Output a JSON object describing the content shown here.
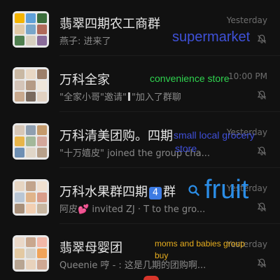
{
  "chats": [
    {
      "title": "翡翠四期农工商群",
      "keycap": "",
      "preview_parts": [
        "燕子: 进来了"
      ],
      "time": "Yesterday",
      "muted": true,
      "avatar_tiles": [
        "#f4b400",
        "#5fa0d8",
        "#3c6e3c",
        "#e0c9a6",
        "#79a6c9",
        "#b06a5a",
        "#4f7f4f",
        "#d8d0c0",
        "#8a6c9a"
      ]
    },
    {
      "title": "万科全家",
      "keycap": "",
      "preview_parts": [
        "\"全家小哥\"邀请\"",
        "\"加入了群聊"
      ],
      "time": "10:00 PM",
      "muted": true,
      "avatar_tiles": [
        "#c9b8a3",
        "#e8d7c4",
        "#9c7f6a",
        "#d4c4b8",
        "#b59b86",
        "#efe6da",
        "#c8a98e",
        "#7a6a5e",
        "#e2d2c2"
      ]
    },
    {
      "title": "万科清美团购。四期",
      "keycap": "",
      "preview_parts": [
        "\"十万嬉皮\" joined the group cha..."
      ],
      "time": "Yesterday",
      "muted": true,
      "avatar_tiles": [
        "#d7c7b7",
        "#8f9fb0",
        "#c49a6c",
        "#e8b54a",
        "#a3b89a",
        "#d3a79b",
        "#6e8fb3",
        "#e0d6c8",
        "#b7a08a"
      ]
    },
    {
      "title": "万科水果群四期",
      "keycap": "4",
      "title_suffix": "群",
      "preview_parts": [
        "阿皮",
        " invited ZJ · T to the gro..."
      ],
      "time": "Yesterday",
      "muted": true,
      "avatar_tiles": [
        "#e6d5c2",
        "#c2a48c",
        "#f0e0d0",
        "#b9c6d4",
        "#e0b48a",
        "#d99d8a",
        "#a8907a",
        "#f2cfb2",
        "#c8b6a0"
      ]
    },
    {
      "title": "翡翠母婴团",
      "keycap": "",
      "preview_parts": [
        "Queenie 哼 - : 这是几期的团购啊..."
      ],
      "time": "Yesterday",
      "muted": true,
      "avatar_tiles": [
        "#ead8c8",
        "#c9a78e",
        "#f2b8a8",
        "#e3c9a2",
        "#d6d0c6",
        "#f0a45a",
        "#b8a592",
        "#e8d2bc",
        "#cfa893"
      ]
    }
  ],
  "annotations": {
    "supermarket": "supermarket",
    "convenience": "convenience store",
    "small_line1": "small local grocery",
    "small_line2": "store",
    "fruit": "fruit",
    "moms_line1": "moms and babies group",
    "moms_line2": "buy"
  },
  "colors": {
    "background": "#111111",
    "title_text": "#e6e6e6",
    "preview_text": "#8a8a8a",
    "time_text": "#6e6e6e"
  },
  "icons": {
    "mute": "bell-slash-icon",
    "search": "search-icon"
  }
}
